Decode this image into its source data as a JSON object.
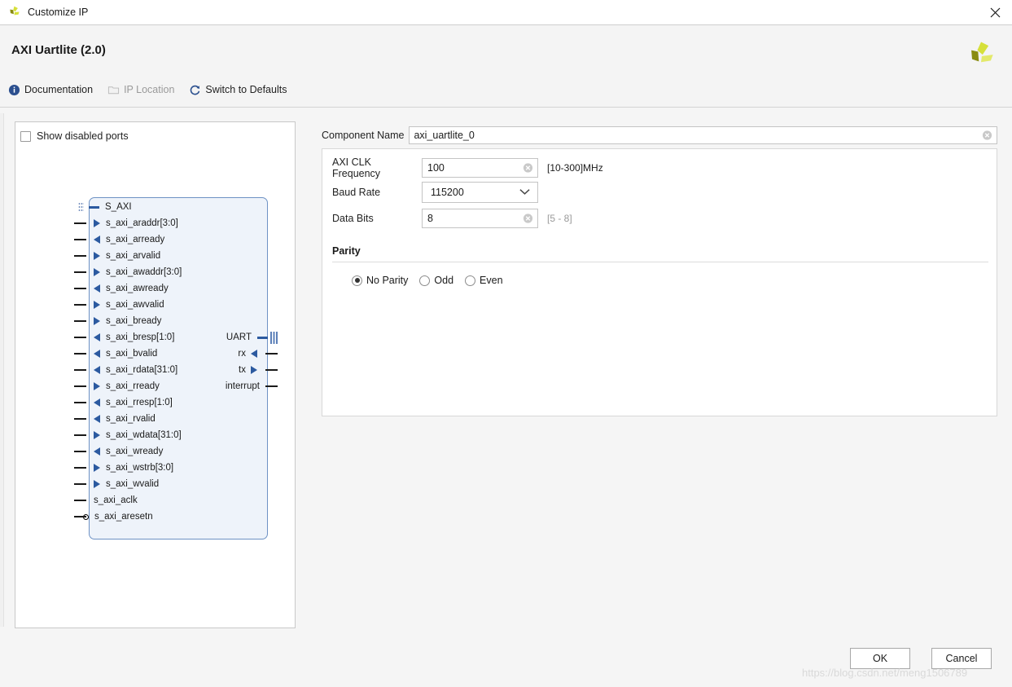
{
  "window": {
    "title": "Customize IP",
    "icon": "xilinx-logo-icon",
    "close_label": "✕"
  },
  "header": {
    "ip_title": "AXI Uartlite (2.0)",
    "logo": "xilinx-logo-icon",
    "toolbar": [
      {
        "label": "Documentation",
        "icon": "info-icon",
        "enabled": true
      },
      {
        "label": "IP Location",
        "icon": "folder-icon",
        "enabled": false
      },
      {
        "label": "Switch to Defaults",
        "icon": "refresh-icon",
        "enabled": true
      }
    ]
  },
  "diagram": {
    "show_disabled_ports": {
      "label": "Show disabled ports",
      "checked": false
    },
    "bus_label": "S_AXI",
    "left_ports": [
      {
        "name": "s_axi_araddr[3:0]",
        "dir": "in"
      },
      {
        "name": "s_axi_arready",
        "dir": "out"
      },
      {
        "name": "s_axi_arvalid",
        "dir": "in"
      },
      {
        "name": "s_axi_awaddr[3:0]",
        "dir": "in"
      },
      {
        "name": "s_axi_awready",
        "dir": "out"
      },
      {
        "name": "s_axi_awvalid",
        "dir": "in"
      },
      {
        "name": "s_axi_bready",
        "dir": "in"
      },
      {
        "name": "s_axi_bresp[1:0]",
        "dir": "out"
      },
      {
        "name": "s_axi_bvalid",
        "dir": "out"
      },
      {
        "name": "s_axi_rdata[31:0]",
        "dir": "out"
      },
      {
        "name": "s_axi_rready",
        "dir": "in"
      },
      {
        "name": "s_axi_rresp[1:0]",
        "dir": "out"
      },
      {
        "name": "s_axi_rvalid",
        "dir": "out"
      },
      {
        "name": "s_axi_wdata[31:0]",
        "dir": "in"
      },
      {
        "name": "s_axi_wready",
        "dir": "out"
      },
      {
        "name": "s_axi_wstrb[3:0]",
        "dir": "in"
      },
      {
        "name": "s_axi_wvalid",
        "dir": "in"
      }
    ],
    "clock_ports": [
      {
        "name": "s_axi_aclk",
        "marker": "plain"
      },
      {
        "name": "s_axi_aresetn",
        "marker": "inverted"
      }
    ],
    "right_ports": [
      {
        "name": "UART",
        "dir": "bus"
      },
      {
        "name": "rx",
        "dir": "out"
      },
      {
        "name": "tx",
        "dir": "in"
      },
      {
        "name": "interrupt",
        "dir": "plain"
      }
    ]
  },
  "form": {
    "component_name": {
      "label": "Component Name",
      "value": "axi_uartlite_0"
    },
    "axi_clk_frequency": {
      "label": "AXI CLK Frequency",
      "value": "100",
      "hint": "[10-300]MHz"
    },
    "baud_rate": {
      "label": "Baud Rate",
      "value": "115200"
    },
    "data_bits": {
      "label": "Data Bits",
      "value": "8",
      "hint": "[5 - 8]"
    },
    "parity": {
      "title": "Parity",
      "options": [
        {
          "label": "No Parity",
          "selected": true
        },
        {
          "label": "Odd",
          "selected": false
        },
        {
          "label": "Even",
          "selected": false
        }
      ]
    }
  },
  "footer": {
    "ok_label": "OK",
    "cancel_label": "Cancel"
  },
  "watermark": {
    "text": "https://blog.csdn.net/meng1506789"
  },
  "colors": {
    "accent_blue": "#2c5aa0",
    "block_fill": "#eef3fa",
    "block_border": "#6e92c4",
    "logo_dark": "#8a8c10",
    "logo_light": "#d6e03a"
  }
}
